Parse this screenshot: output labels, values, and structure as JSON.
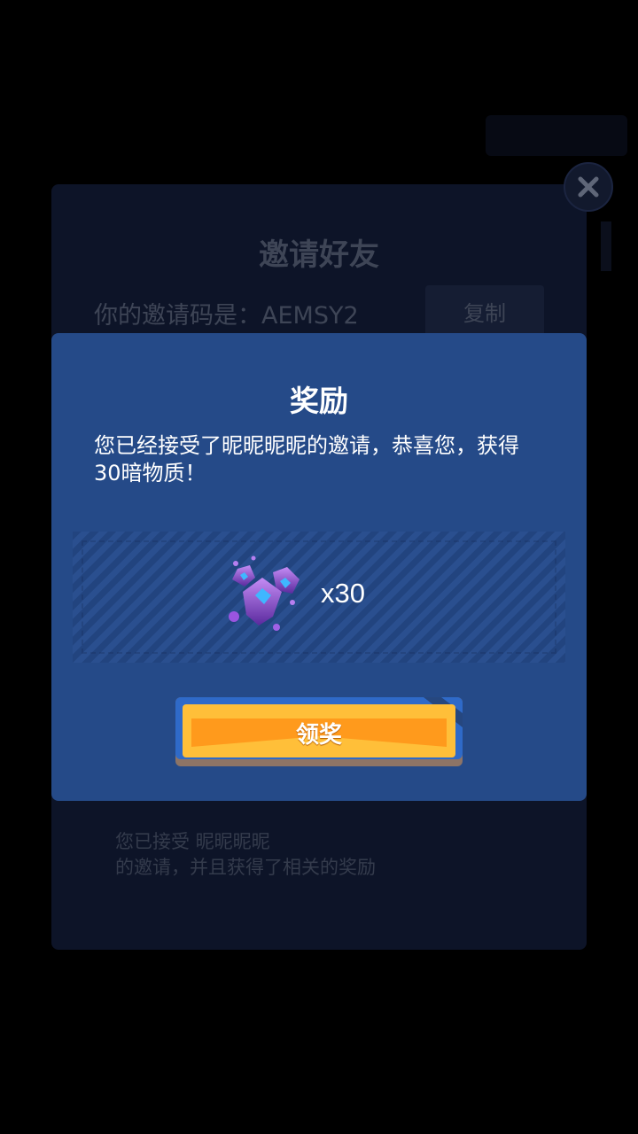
{
  "invite": {
    "title": "邀请好友",
    "code_label": "你的邀请码是：AEMSY2",
    "copy_label": "复制",
    "accepted_line1": "您已接受 昵昵昵昵",
    "accepted_line2": "的邀请，并且获得了相关的奖励"
  },
  "reward": {
    "title": "奖励",
    "message": "您已经接受了昵昵昵昵的邀请，恭喜您，获得30暗物质！",
    "item_icon": "dark-matter-gem-icon",
    "quantity": "x30",
    "claim_label": "领奖"
  },
  "colors": {
    "dialog_bg": "#254a88",
    "button_orange": "#ffb43a",
    "gem_purple": "#8f4fd6"
  }
}
